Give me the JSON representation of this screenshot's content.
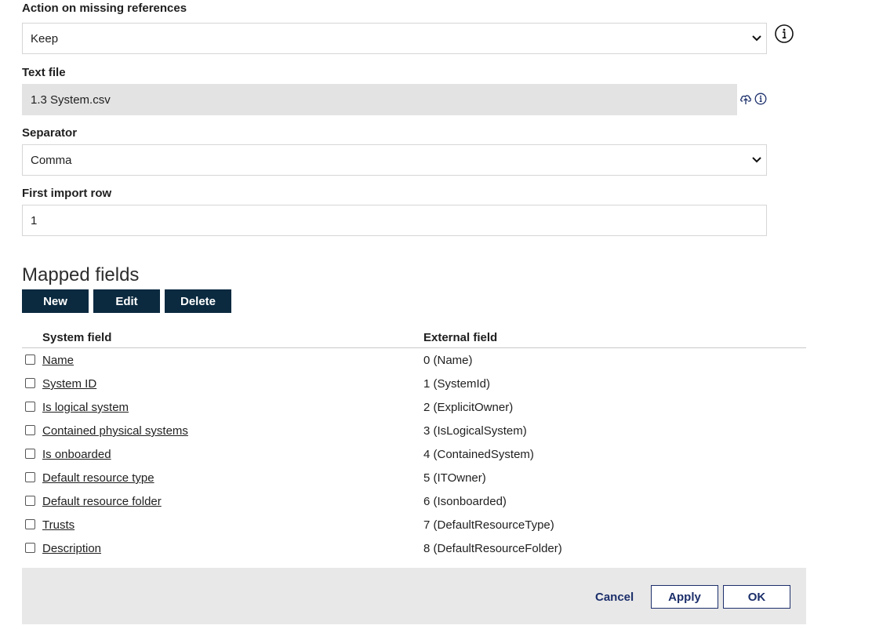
{
  "form": {
    "missing_refs": {
      "label": "Action on missing references",
      "value": "Keep"
    },
    "text_file": {
      "label": "Text file",
      "value": "1.3 System.csv"
    },
    "separator": {
      "label": "Separator",
      "value": "Comma"
    },
    "first_row": {
      "label": "First import row",
      "value": "1"
    }
  },
  "icons": {
    "info": "info-icon",
    "upload": "cloud-upload-icon",
    "dropdown": "chevron-down-icon"
  },
  "mapped": {
    "title": "Mapped fields",
    "buttons": {
      "new": "New",
      "edit": "Edit",
      "delete": "Delete"
    },
    "headers": {
      "system": "System field",
      "external": "External field"
    },
    "rows": [
      {
        "system": "Name",
        "external": "0 (Name)"
      },
      {
        "system": "System ID",
        "external": "1 (SystemId)"
      },
      {
        "system": "Is logical system",
        "external": "2 (ExplicitOwner)"
      },
      {
        "system": "Contained physical systems",
        "external": "3 (IsLogicalSystem)"
      },
      {
        "system": "Is onboarded",
        "external": "4 (ContainedSystem)"
      },
      {
        "system": "Default resource type",
        "external": "5 (ITOwner)"
      },
      {
        "system": "Default resource folder",
        "external": "6 (Isonboarded)"
      },
      {
        "system": "Trusts",
        "external": "7 (DefaultResourceType)"
      },
      {
        "system": "Description",
        "external": "8 (DefaultResourceFolder)"
      }
    ]
  },
  "footer": {
    "cancel": "Cancel",
    "apply": "Apply",
    "ok": "OK"
  },
  "colors": {
    "dark_button": "#0b2a40",
    "accent": "#1c2f6b",
    "disabled_field": "#e3e3e3",
    "footer_bg": "#e8e8e8"
  }
}
